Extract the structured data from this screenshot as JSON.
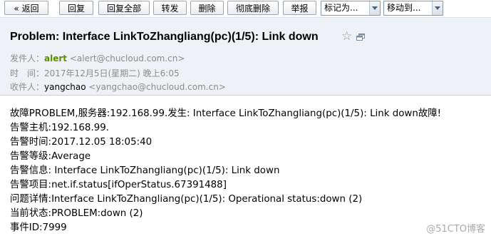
{
  "toolbar": {
    "back_label": "« 返回",
    "reply_label": "回复",
    "reply_all_label": "回复全部",
    "forward_label": "转发",
    "delete_label": "删除",
    "delete_perm_label": "彻底删除",
    "report_label": "举报",
    "mark_as_value": "标记为...",
    "move_to_value": "移动到..."
  },
  "mail": {
    "subject": "Problem: Interface LinkToZhangliang(pc)(1/5): Link down",
    "sender_label": "发件人：",
    "sender_name": "alert",
    "sender_addr": "<alert@chucloud.com.cn>",
    "time_label": "时　间：",
    "time_value": "2017年12月5日(星期二) 晚上6:05",
    "receiver_label": "收件人：",
    "receiver_name": "yangchao",
    "receiver_addr": "<yangchao@chucloud.com.cn>"
  },
  "body_lines": {
    "line1": "故障PROBLEM,服务器:192.168.99.发生: Interface LinkToZhangliang(pc)(1/5): Link down故障!",
    "line2": "告警主机:192.168.99.",
    "line3": "告警时间:2017.12.05 18:05:40",
    "line4": "告警等级:Average",
    "line5": "告警信息: Interface LinkToZhangliang(pc)(1/5): Link down",
    "line6": "告警项目:net.if.status[ifOperStatus.67391488]",
    "line7": "问题详情:Interface LinkToZhangliang(pc)(1/5): Operational status:down (2)",
    "line8": "当前状态:PROBLEM:down (2)",
    "line9": "事件ID:7999"
  },
  "watermark": "@51CTO博客",
  "colors": {
    "sender_green": "#5a8f00",
    "header_bg": "#eef1f5",
    "meta_gray": "#8c8c8c"
  }
}
